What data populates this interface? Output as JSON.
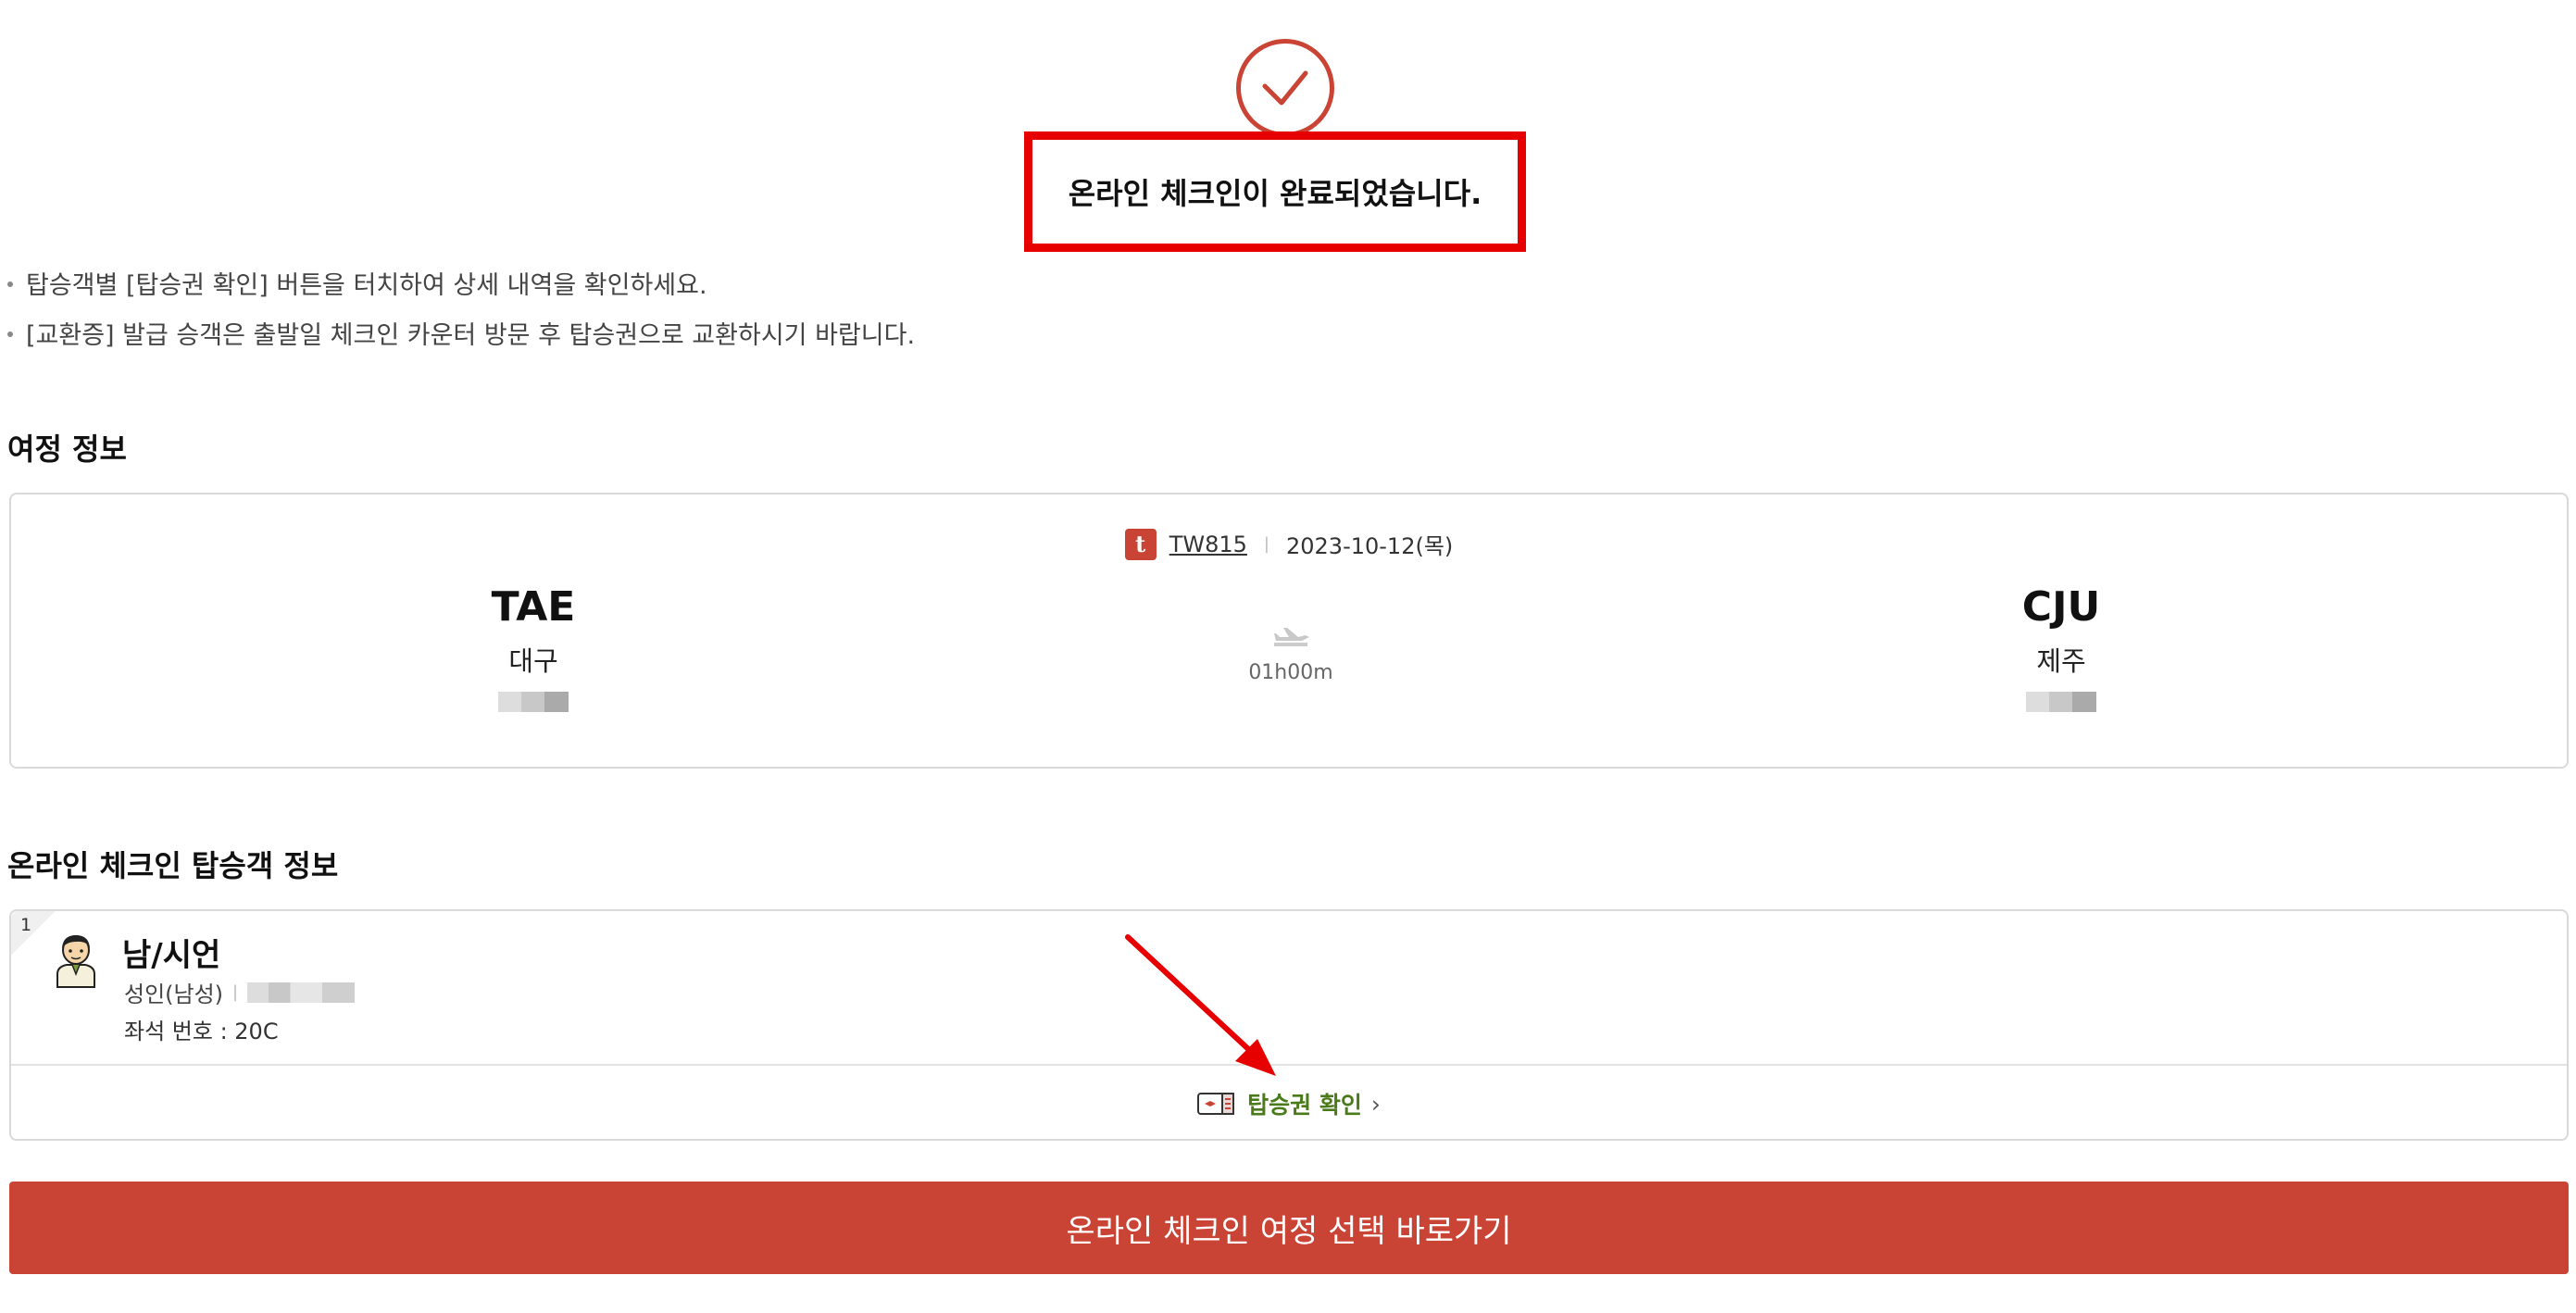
{
  "header": {
    "title": "온라인 체크인이 완료되었습니다.",
    "notices": [
      "탑승객별 [탑승권 확인] 버튼을 터치하여 상세 내역을 확인하세요.",
      "[교환증] 발급 승객은 출발일 체크인 카운터 방문 후 탑승권으로 교환하시기 바랍니다."
    ]
  },
  "itinerary": {
    "section_title": "여정 정보",
    "airline_logo": "t",
    "flight_number": "TW815",
    "date": "2023-10-12(목)",
    "origin": {
      "code": "TAE",
      "city": "대구"
    },
    "destination": {
      "code": "CJU",
      "city": "제주"
    },
    "duration": "01h00m"
  },
  "passengers": {
    "section_title": "온라인 체크인 탑승객 정보",
    "list": [
      {
        "index": "1",
        "name": "남/시언",
        "type": "성인(남성)",
        "seat": "좌석 번호 : 20C",
        "boarding_pass_label": "탑승권 확인",
        "chevron": "›"
      }
    ]
  },
  "cta": {
    "label": "온라인 체크인 여정 선택 바로가기"
  },
  "colors": {
    "accent": "#c94434",
    "highlight": "#e60000",
    "link": "#4a7a1a"
  }
}
